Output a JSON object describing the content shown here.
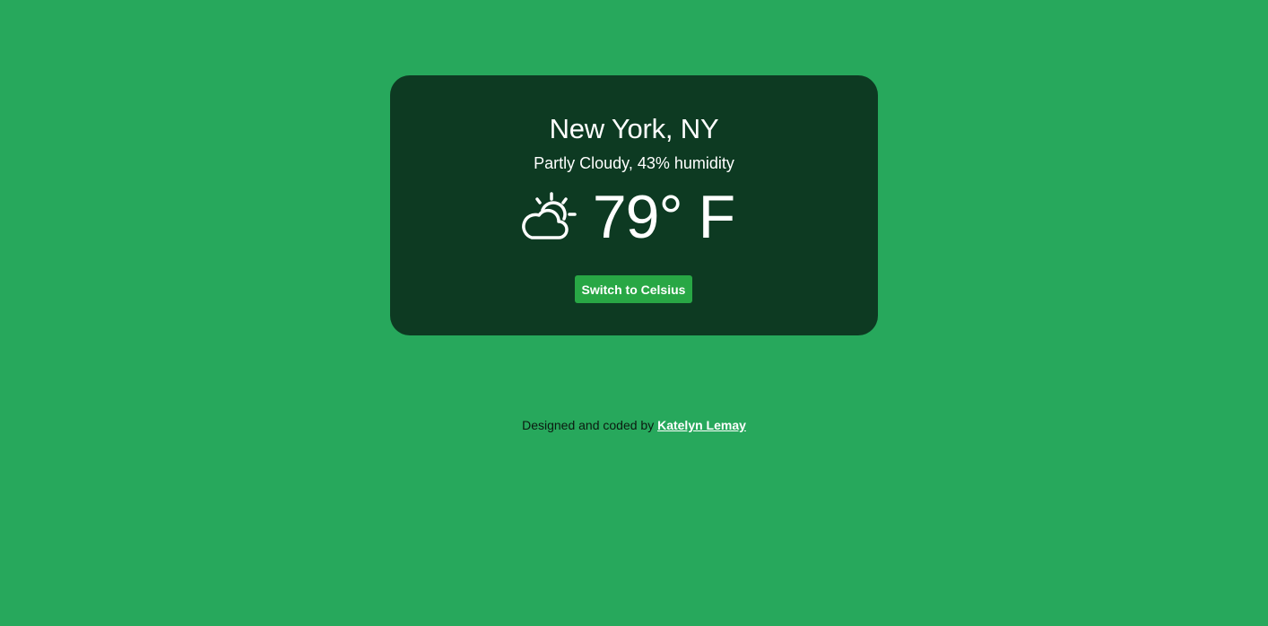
{
  "weather": {
    "city": "New York, NY",
    "description": "Partly Cloudy, 43% humidity",
    "temperature": "79° F",
    "icon": "partly-cloudy-icon",
    "switch_label": "Switch to Celsius"
  },
  "footer": {
    "prefix": "Designed and coded by ",
    "author_link": "Katelyn Lemay"
  },
  "colors": {
    "background": "#27a85c",
    "card": "#0d3a22",
    "button": "#28a745"
  }
}
